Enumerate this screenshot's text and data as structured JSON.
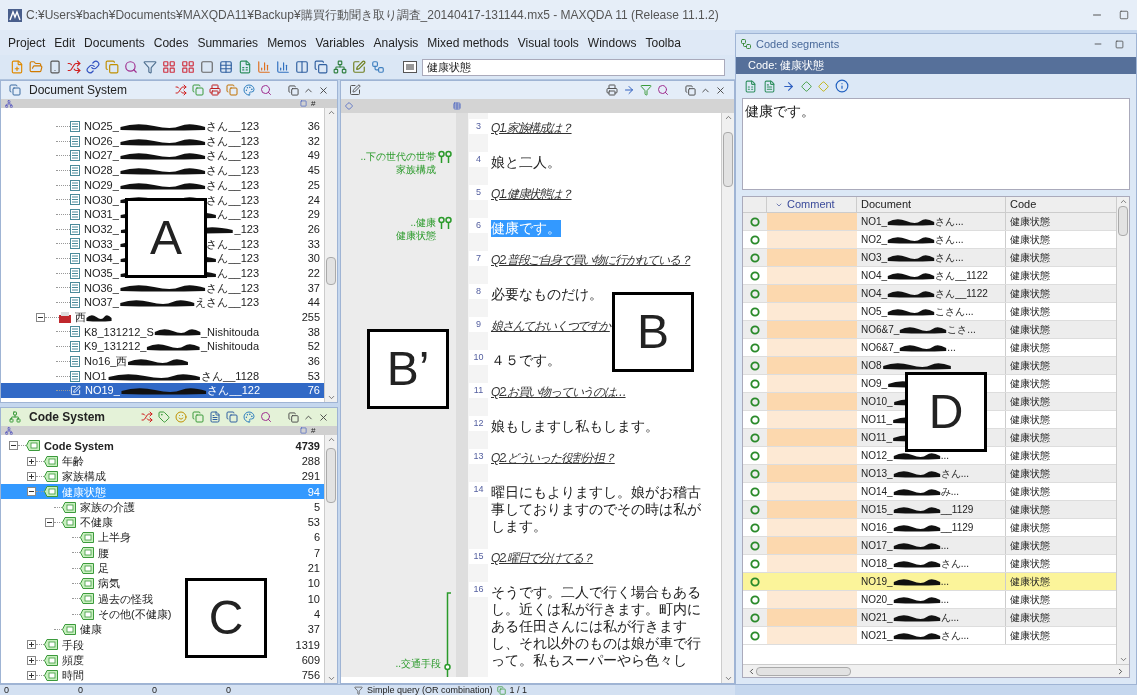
{
  "window": {
    "title": "C:¥Users¥bach¥Documents¥MAXQDA11¥Backup¥購買行動聞き取り調査_20140417-131144.mx5 - MAXQDA 11  (Release 11.1.2)"
  },
  "menu": [
    "Project",
    "Edit",
    "Documents",
    "Codes",
    "Summaries",
    "Memos",
    "Variables",
    "Analysis",
    "Mixed methods",
    "Visual tools",
    "Windows",
    "Toolba"
  ],
  "toolbar": {
    "code_field": {
      "value": "健康状態"
    }
  },
  "document_system": {
    "title": "Document System",
    "count_header": "#",
    "tree": [
      {
        "kind": "continued",
        "children": [
          {
            "kind": "document",
            "label_start": "NO25_",
            "label_end": "さん__123",
            "count": "36",
            "selected": false
          },
          {
            "kind": "document",
            "label_start": "NO26_",
            "label_end": "さん__123",
            "count": "32",
            "selected": false
          },
          {
            "kind": "document",
            "label_start": "NO27_",
            "label_end": "さん__123",
            "count": "49",
            "selected": false
          },
          {
            "kind": "document",
            "label_start": "NO28_",
            "label_end": "さん__123",
            "count": "45",
            "selected": false
          },
          {
            "kind": "document",
            "label_start": "NO29_",
            "label_end": "さん__123",
            "count": "25",
            "selected": false
          },
          {
            "kind": "document",
            "label_start": "NO30_",
            "label_end": "さん__123",
            "count": "24",
            "selected": false
          },
          {
            "kind": "document",
            "label_start": "NO31_",
            "label_end": "ん__123",
            "count": "29",
            "selected": false
          },
          {
            "kind": "document",
            "label_start": "NO32_",
            "label_end": "_123",
            "count": "26",
            "selected": false
          },
          {
            "kind": "document",
            "label_start": "NO33_",
            "label_end": "さん__123",
            "count": "33",
            "selected": false
          },
          {
            "kind": "document",
            "label_start": "NO34_",
            "label_end": "ん__123",
            "count": "30",
            "selected": false
          },
          {
            "kind": "document",
            "label_start": "NO35_",
            "label_end": "ん__123",
            "count": "22",
            "selected": false
          },
          {
            "kind": "document",
            "label_start": "NO36_",
            "label_end": "さん__123",
            "count": "37",
            "selected": false
          },
          {
            "kind": "document",
            "label_start": "NO37_",
            "label_end": "えさん__123",
            "count": "44",
            "selected": false
          }
        ]
      },
      {
        "kind": "set",
        "label_start": "西",
        "expanded": true,
        "count": "255",
        "children": [
          {
            "kind": "document",
            "label_start": "K8_131212_S",
            "label_end": "_Nishitouda",
            "count": "38",
            "selected": false
          },
          {
            "kind": "document",
            "label_start": "K9_131212_",
            "label_end": "_Nishitouda",
            "count": "52",
            "selected": false
          },
          {
            "kind": "document",
            "label_start": "No16_西",
            "count": "36",
            "selected": false
          },
          {
            "kind": "document",
            "label_start": "NO1",
            "label_end": "さん__1128",
            "count": "53",
            "selected": false
          },
          {
            "kind": "document",
            "label_start": "NO19_",
            "label_end": "さん__122",
            "count": "76",
            "selected": true
          }
        ]
      }
    ]
  },
  "code_system": {
    "title": "Code System",
    "count_header": "#",
    "tree": [
      {
        "label": "Code System",
        "count": "4739",
        "root": true,
        "expanded": true,
        "selected": false,
        "children": [
          {
            "label": "年齢",
            "count": "288",
            "expanded": false,
            "selected": false
          },
          {
            "label": "家族構成",
            "count": "291",
            "expanded": false,
            "selected": false
          },
          {
            "label": "健康状態",
            "count": "94",
            "expanded": true,
            "selected": true,
            "children": [
              {
                "label": "家族の介護",
                "count": "5",
                "selected": false
              },
              {
                "label": "不健康",
                "count": "53",
                "expanded": true,
                "selected": false,
                "children": [
                  {
                    "label": "上半身",
                    "count": "6",
                    "selected": false
                  },
                  {
                    "label": "腰",
                    "count": "7",
                    "selected": false
                  },
                  {
                    "label": "足",
                    "count": "21",
                    "selected": false
                  },
                  {
                    "label": "病気",
                    "count": "10",
                    "selected": false
                  },
                  {
                    "label": "過去の怪我",
                    "count": "10",
                    "selected": false
                  },
                  {
                    "label": "その他(不健康)",
                    "count": "4",
                    "selected": false
                  }
                ]
              },
              {
                "label": "健康",
                "count": "37",
                "selected": false
              }
            ]
          },
          {
            "label": "手段",
            "count": "1319",
            "expanded": false,
            "selected": false
          },
          {
            "label": "頻度",
            "count": "609",
            "expanded": false,
            "selected": false
          },
          {
            "label": "時間",
            "count": "756",
            "expanded": false,
            "selected": false
          }
        ]
      }
    ]
  },
  "document_browser": {
    "paragraphs": [
      {
        "number": "3",
        "kind": "question",
        "text": "Q1.家族構成は？"
      },
      {
        "number": "4",
        "kind": "answer",
        "text": "娘と二人。",
        "codes": [
          {
            "kind": "point",
            "subcode": "..下の世代の世帯",
            "code": "家族構成"
          }
        ]
      },
      {
        "number": "5",
        "kind": "question",
        "text": "Q1.健康状態は？"
      },
      {
        "number": "6",
        "kind": "answer",
        "text": "健康です。",
        "highlighted": true,
        "codes": [
          {
            "kind": "point",
            "subcode": "..健康",
            "code": "健康状態"
          }
        ]
      },
      {
        "number": "7",
        "kind": "question",
        "text": "Q2.普段ご自身で買い物に行かれている？"
      },
      {
        "number": "8",
        "kind": "answer",
        "text": "必要なものだけ。"
      },
      {
        "number": "9",
        "kind": "question",
        "text": "娘さんておいくつですか"
      },
      {
        "number": "10",
        "kind": "answer",
        "text": "４５です。"
      },
      {
        "number": "11",
        "kind": "question",
        "text": "Q2.お買い物っていうのは…"
      },
      {
        "number": "12",
        "kind": "answer",
        "text": "娘もしますし私もします。"
      },
      {
        "number": "13",
        "kind": "question",
        "text": "Q2.どういった役割分担？"
      },
      {
        "number": "14",
        "kind": "answer",
        "text": "曜日にもよりますし。娘がお稽古事しておりますのでその時は私がします。"
      },
      {
        "number": "15",
        "kind": "question",
        "text": "Q2.曜日で分けてる？"
      },
      {
        "number": "16",
        "kind": "answer",
        "text": "そうです。二人で行く場合もあるし。近くは私が行きます。町内にある任田さんには私が行きますし、それ以外のものは娘が車で行って。私もスーパーやら色々し",
        "codes": [
          {
            "kind": "bracket",
            "subcode": "..交通手段"
          }
        ]
      }
    ]
  },
  "coded_segments": {
    "title": "Coded segments",
    "code_label": "Code: 健康状態",
    "preview": "健康です。",
    "columns": [
      "Comment",
      "Document",
      "Code"
    ],
    "rows": [
      {
        "doc_start": "NO1_",
        "doc_end": "さん...",
        "code": "健康状態",
        "selected": false
      },
      {
        "doc_start": "NO2_",
        "doc_end": "さん...",
        "code": "健康状態",
        "selected": false
      },
      {
        "doc_start": "NO3_",
        "doc_end": "さん...",
        "code": "健康状態",
        "selected": false
      },
      {
        "doc_start": "NO4_",
        "doc_end": "さん__1122",
        "code": "健康状態",
        "selected": false
      },
      {
        "doc_start": "NO4_",
        "doc_end": "さん__1122",
        "code": "健康状態",
        "selected": false
      },
      {
        "doc_start": "NO5_",
        "doc_end": "こさん...",
        "code": "健康状態",
        "selected": false
      },
      {
        "doc_start": "NO6&7_",
        "doc_end": "こさ...",
        "code": "健康状態",
        "selected": false
      },
      {
        "doc_start": "NO6&7_",
        "doc_end": "...",
        "code": "健康状態",
        "selected": false
      },
      {
        "doc_start": "NO8",
        "code": "健康状態",
        "selected": false
      },
      {
        "doc_start": "NO9_",
        "code": "健康状態",
        "selected": false
      },
      {
        "doc_start": "NO10_",
        "code": "健康状態",
        "selected": false
      },
      {
        "doc_start": "NO11_",
        "code": "健康状態",
        "selected": false
      },
      {
        "doc_start": "NO11_",
        "code": "健康状態",
        "selected": false
      },
      {
        "doc_start": "NO12_",
        "doc_end": "...",
        "code": "健康状態",
        "selected": false
      },
      {
        "doc_start": "NO13_",
        "doc_end": "さん...",
        "code": "健康状態",
        "selected": false
      },
      {
        "doc_start": "NO14_",
        "doc_end": "み...",
        "code": "健康状態",
        "selected": false
      },
      {
        "doc_start": "NO15_",
        "doc_end": "__1129",
        "code": "健康状態",
        "selected": false
      },
      {
        "doc_start": "NO16_",
        "doc_end": "__1129",
        "code": "健康状態",
        "selected": false
      },
      {
        "doc_start": "NO17_",
        "doc_end": "...",
        "code": "健康状態",
        "selected": false
      },
      {
        "doc_start": "NO18_",
        "doc_end": "さん...",
        "code": "健康状態",
        "selected": false
      },
      {
        "doc_start": "NO19_",
        "doc_end": "...",
        "code": "健康状態",
        "selected": true
      },
      {
        "doc_start": "NO20_",
        "doc_end": "...",
        "code": "健康状態",
        "selected": false
      },
      {
        "doc_start": "NO21_",
        "doc_end": "ん...",
        "code": "健康状態",
        "selected": false
      },
      {
        "doc_start": "NO21_",
        "doc_end": "さん...",
        "code": "健康状態",
        "selected": false
      }
    ]
  },
  "status_bar": {
    "counters": [
      "0",
      "0",
      "0",
      "0"
    ],
    "query": "Simple query (OR combination)",
    "pages": "1 / 1"
  },
  "annotation_boxes": [
    {
      "label": "A"
    },
    {
      "label": "B"
    },
    {
      "label": "B’"
    },
    {
      "label": "C"
    },
    {
      "label": "D"
    }
  ]
}
